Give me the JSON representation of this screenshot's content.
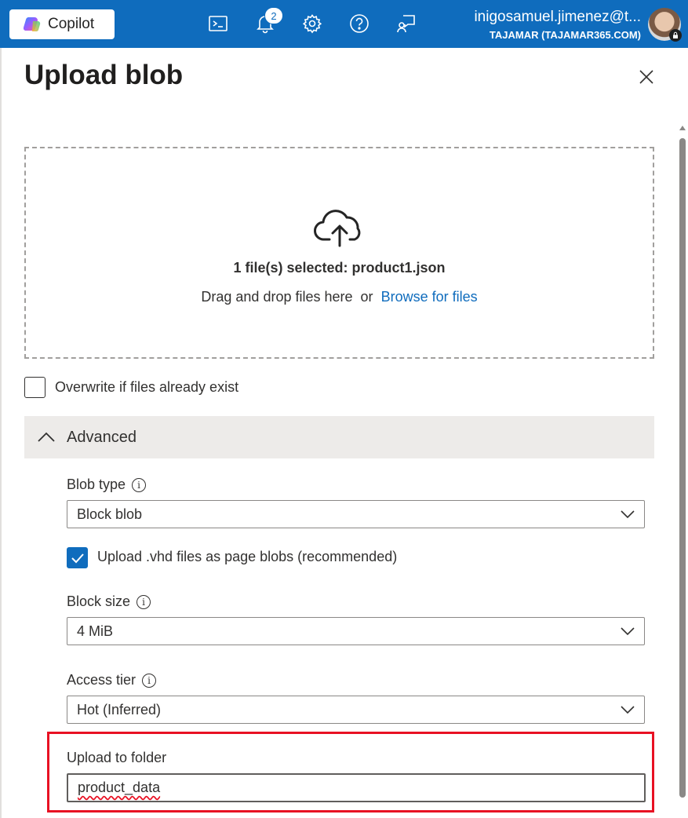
{
  "topbar": {
    "copilot_label": "Copilot",
    "notification_count": "2",
    "account_name": "inigosamuel.jimenez@t...",
    "account_tenant": "TAJAMAR (TAJAMAR365.COM)",
    "icons": [
      "cloud-shell-icon",
      "bell-icon",
      "gear-icon",
      "help-icon",
      "feedback-icon"
    ]
  },
  "panel": {
    "title": "Upload blob"
  },
  "dropzone": {
    "selected_text": "1 file(s) selected: product1.json",
    "drag_text": "Drag and drop files here",
    "or_text": "or",
    "browse_label": "Browse for files"
  },
  "overwrite": {
    "label": "Overwrite if files already exist",
    "checked": false
  },
  "advanced": {
    "label": "Advanced",
    "expanded": true,
    "blob_type": {
      "label": "Blob type",
      "value": "Block blob"
    },
    "vhd_checkbox": {
      "label": "Upload .vhd files as page blobs (recommended)",
      "checked": true
    },
    "block_size": {
      "label": "Block size",
      "value": "4 MiB"
    },
    "access_tier": {
      "label": "Access tier",
      "value": "Hot (Inferred)"
    },
    "upload_folder": {
      "label": "Upload to folder",
      "value": "product_data"
    }
  },
  "colors": {
    "topbar": "#0f6cbd",
    "link": "#0f6cbd",
    "highlight": "#e81123",
    "advanced_bg": "#edebe9"
  }
}
